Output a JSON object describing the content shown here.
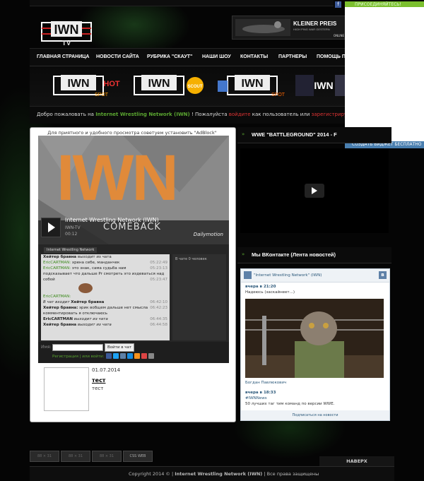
{
  "topbar": {
    "fb": "f",
    "vk_join": "ПРИСОЕДИНЯЙТЕСЬ!"
  },
  "header": {
    "banner_line1": "KLEINER PREIS",
    "banner_line2": "HIGH PING WAR GESTERN",
    "banner_online": "ONLINE"
  },
  "nav": {
    "items": [
      "ГЛАВНАЯ СТРАНИЦА",
      "НОВОСТИ САЙТА",
      "РУБРИКА \"СКАУТ\"",
      "НАШИ ШОУ",
      "КОНТАКТЫ",
      "ПАРТНЕРЫ",
      "ПОМОЩЬ П"
    ]
  },
  "welcome": {
    "pre": "Добро пожаловать на",
    "site": "Internet Wrestling Network (IWN)",
    "mid": "! Пожалуйста",
    "login": "войдите",
    "mid2": "как пользователь или",
    "register": "зарегистрируйтесь",
    "end": "!"
  },
  "vk_side": {
    "create": "СОЗДАТЬ ВИДЖЕТ БЕСПЛАТНО"
  },
  "main": {
    "adblock": "Для приятного и удобного просмотра советуем установить \"AdBlock\"",
    "video_big": "IWN",
    "video_title": "Internet Wrestling Network (IWN)",
    "video_channel": "IWN-TV",
    "video_time": "00:12",
    "video_overlay": "COMEBACK",
    "video_brand": "Dailymotion",
    "chat_tab": "Internet Wrestling Network",
    "chat_lines": [
      {
        "name": "Хейтер бравна",
        "text": "выходит из чата",
        "time": "",
        "green": false
      },
      {
        "name": "EricCARTMAN:",
        "text": "хрена себе, манданчек",
        "time": "05:22:49",
        "green": true
      },
      {
        "name": "EricCARTMAN:",
        "text": "это знак, сама судьба нам",
        "time": "05:23:13",
        "green": true
      },
      {
        "name": "",
        "text": "подсказывает что дальше Pr смотреть это издеваться над",
        "time": "",
        "green": false
      },
      {
        "name": "",
        "text": "собой",
        "time": "05:23:47",
        "green": false
      },
      {
        "name": "EricCARTMAN:",
        "text": "",
        "time": "",
        "green": true
      },
      {
        "name": "В чат входит",
        "text": "Хейтер бравна",
        "time": "06:42:10",
        "green": false
      },
      {
        "name": "Хейтер бравна:",
        "text": "эрик вобщем дальше нет смысла",
        "time": "06:42:23",
        "green": false
      },
      {
        "name": "",
        "text": "комментировать я отключаюсь",
        "time": "",
        "green": false
      },
      {
        "name": "EricCARTMAN",
        "text": "выходит из чата",
        "time": "06:44:35",
        "green": false
      },
      {
        "name": "Хейтер бравна",
        "text": "выходит из чата",
        "time": "06:44:58",
        "green": false
      }
    ],
    "chat_online": "В чате 0 человек",
    "chat_name_label": "Имя:",
    "chat_send": "Войти в чат",
    "chat_reg": "Регистрация | или войти:",
    "news_date": "01.07.2014",
    "news_title": "тест",
    "news_text": "тест"
  },
  "right": {
    "video_head": "WWE \"BATTLEGROUND\" 2014 - F",
    "vk_head": "Мы ВКонтакте (Лента новостей)",
    "vk_group": "\"Internet Wrestling Network\" (IWN)",
    "vk_time1": "вчера в 21:20",
    "vk_text1": "Надеюсь (заскайнеет...)",
    "vk_author": "Богдан Павлюкович",
    "vk_time2": "вчера в 18:33",
    "vk_tag": "#IWNNews",
    "vk_text2": "50 лучших таг тим команд по версии WWE.",
    "vk_subscribe": "Подписаться на новости"
  },
  "bottom": {
    "buttons": [
      "88 × 31",
      "88 × 31",
      "88 × 31",
      "CSS WEB"
    ],
    "to_top": "НАВЕРХ",
    "copyright_pre": "Copyright 2014 ©",
    "copyright_site": "Internet Wrestling Network (IWN)",
    "copyright_post": "| Все права защищены"
  },
  "colors": {
    "accent_green": "#5aa530",
    "link_red": "#dd3333",
    "vk_blue": "#4a7fb0"
  }
}
